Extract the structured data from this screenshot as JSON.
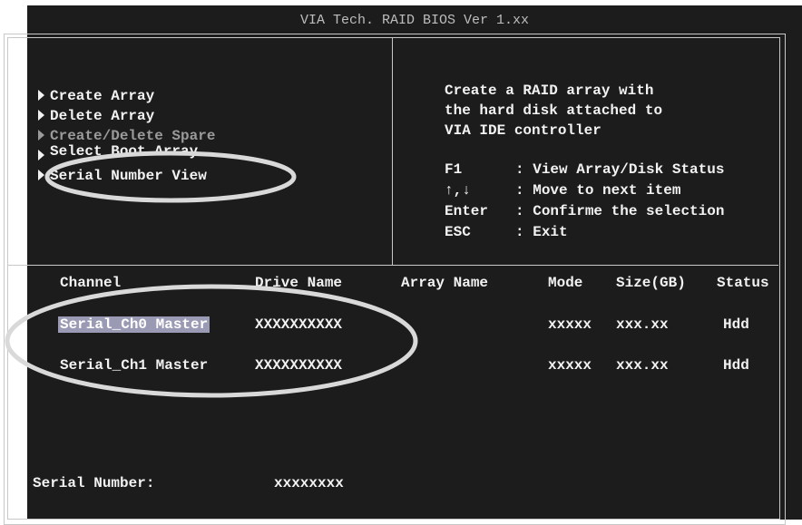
{
  "title": "VIA Tech. RAID BIOS Ver 1.xx",
  "menu": {
    "items": [
      {
        "label": "Create Array"
      },
      {
        "label": "Delete Array"
      },
      {
        "label": "Create/Delete Spare"
      },
      {
        "label": "Select Boot Array"
      },
      {
        "label": "Serial Number View"
      }
    ]
  },
  "help": {
    "description": "Create a RAID array with\nthe hard disk attached to\nVIA IDE controller",
    "keys": [
      {
        "key": "F1",
        "sep": ":",
        "action": "View Array/Disk Status"
      },
      {
        "key": "↑,↓",
        "sep": ":",
        "action": "Move to next item"
      },
      {
        "key": "Enter",
        "sep": ":",
        "action": "Confirme the selection"
      },
      {
        "key": "ESC",
        "sep": ":",
        "action": "Exit"
      }
    ]
  },
  "table": {
    "headers": {
      "channel": "Channel",
      "drive_name": "Drive Name",
      "array_name": "Array Name",
      "mode": "Mode",
      "size": "Size(GB)",
      "status": "Status"
    },
    "rows": [
      {
        "channel": "Serial_Ch0 Master",
        "drive_name": "XXXXXXXXXX",
        "array_name": "",
        "mode": "xxxxx",
        "size": "xxx.xx",
        "status": "Hdd"
      },
      {
        "channel": "Serial_Ch1 Master",
        "drive_name": "XXXXXXXXXX",
        "array_name": "",
        "mode": "xxxxx",
        "size": "xxx.xx",
        "status": "Hdd"
      }
    ]
  },
  "serial": {
    "label": "Serial Number:",
    "value": "xxxxxxxx"
  }
}
